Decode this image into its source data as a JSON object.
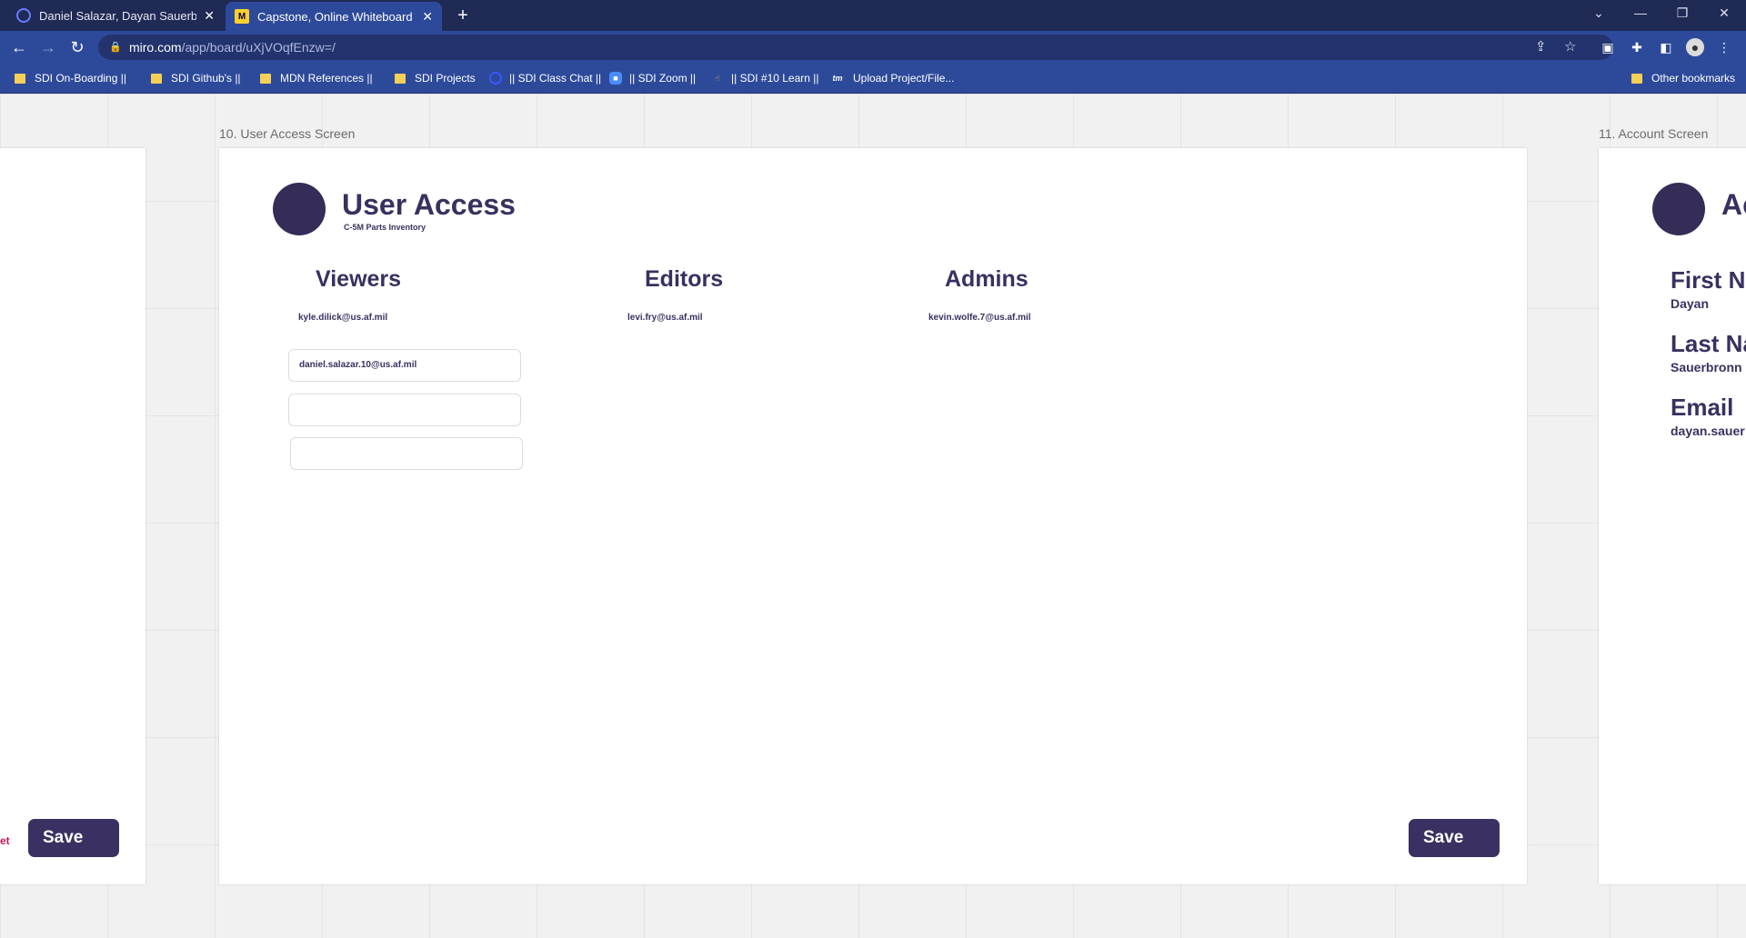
{
  "browser": {
    "tabs": [
      {
        "title": "Daniel Salazar, Dayan Sauerbronn",
        "active": false
      },
      {
        "title": "Capstone, Online Whiteboard for",
        "active": true
      }
    ],
    "new_tab_label": "+",
    "url_host": "miro.com",
    "url_path": "/app/board/uXjVOqfEnzw=/",
    "bookmarks": [
      {
        "label": "SDI On-Boarding ||",
        "icon": "folder-icon"
      },
      {
        "label": "SDI Github's ||",
        "icon": "folder-icon"
      },
      {
        "label": "MDN References ||",
        "icon": "folder-icon"
      },
      {
        "label": "SDI Projects",
        "icon": "folder-icon"
      },
      {
        "label": "|| SDI Class Chat ||",
        "icon": "chat-icon"
      },
      {
        "label": "|| SDI Zoom ||",
        "icon": "zoom-icon"
      },
      {
        "label": "|| SDI #10 Learn ||",
        "icon": "learn-icon"
      },
      {
        "label": "Upload Project/File...",
        "icon": "tm-icon"
      }
    ],
    "other_bookmarks": "Other bookmarks",
    "colors": {
      "tabbar": "#1f2a55",
      "toolbar": "#2d4a9a"
    }
  },
  "board": {
    "left_frame": {
      "save_label": "Save",
      "partial_text": "et"
    },
    "main_frame": {
      "label": "10. User Access Screen",
      "title": "User Access",
      "subtitle": "C-5M Parts Inventory",
      "columns": [
        {
          "heading": "Viewers",
          "emails": [
            "kyle.dilick@us.af.mil"
          ]
        },
        {
          "heading": "Editors",
          "emails": [
            "levi.fry@us.af.mil"
          ]
        },
        {
          "heading": "Admins",
          "emails": [
            "kevin.wolfe.7@us.af.mil"
          ]
        }
      ],
      "inputs": [
        {
          "value": "daniel.salazar.10@us.af.mil"
        },
        {
          "value": ""
        },
        {
          "value": ""
        }
      ],
      "save_label": "Save"
    },
    "right_frame": {
      "label": "11. Account Screen",
      "title": "Ac",
      "fields": [
        {
          "label": "First Na",
          "value": "Dayan"
        },
        {
          "label": "Last Na",
          "value": "Sauerbronn"
        },
        {
          "label": "Email",
          "value": "dayan.sauer"
        }
      ]
    },
    "colors": {
      "primary": "#3a3062",
      "text": "#383160",
      "accent_text": "#c2185b"
    }
  }
}
